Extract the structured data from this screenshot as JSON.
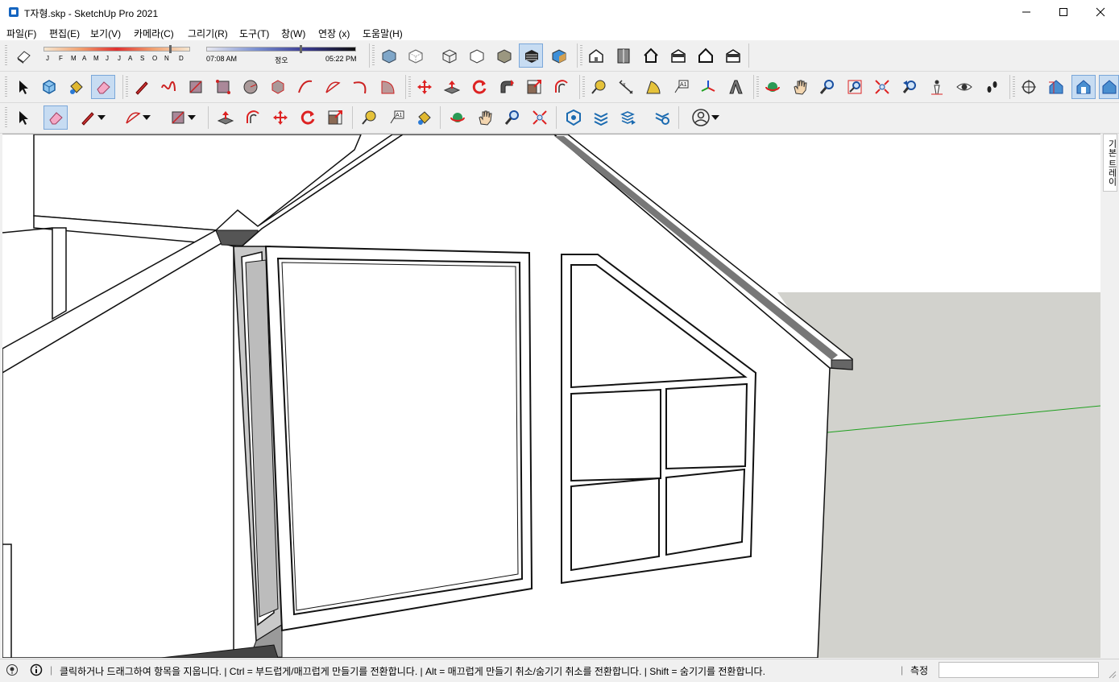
{
  "window": {
    "title": "T자형.skp - SketchUp Pro 2021"
  },
  "menu": [
    "파일(F)",
    "편집(E)",
    "보기(V)",
    "카메라(C)",
    "그리기(R)",
    "도구(T)",
    "창(W)",
    "연장 (x)",
    "도움말(H)"
  ],
  "shadow": {
    "months": [
      "J",
      "F",
      "M",
      "A",
      "M",
      "J",
      "J",
      "A",
      "S",
      "O",
      "N",
      "D"
    ],
    "sunrise": "07:08 AM",
    "noon": "정오",
    "sunset": "05:22 PM"
  },
  "tray": {
    "label": "기본 트레이"
  },
  "status": {
    "text": "클릭하거나 드래그하여 항목을 지웁니다. | Ctrl = 부드럽게/매끄럽게 만들기를 전환합니다. | Alt = 매끄럽게 만들기 취소/숨기기 취소를 전환합니다. | Shift = 숨기기를 전환합니다.",
    "measure_label": "측정",
    "measure_value": ""
  },
  "colors": {
    "axis_green": "#1fa01f",
    "ground": "#d2d2cd",
    "sky": "#ffffff",
    "accent": "#c7dcf2"
  }
}
